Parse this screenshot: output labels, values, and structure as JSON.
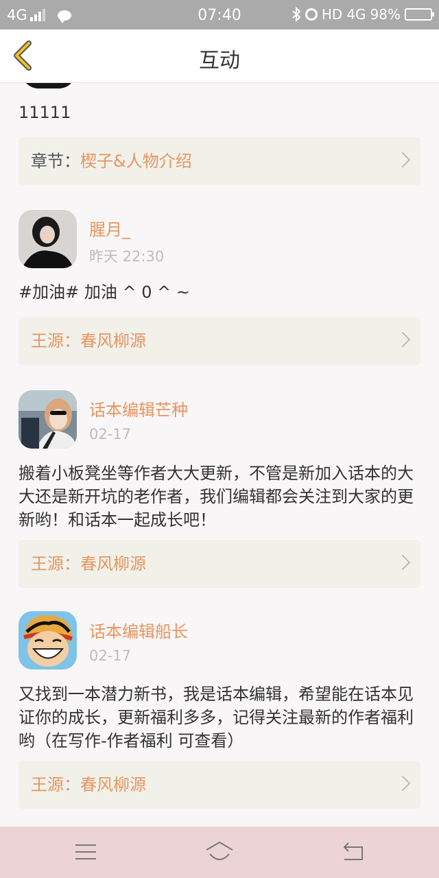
{
  "status_bar": {
    "network": "4G",
    "time": "07:40",
    "hd": "HD",
    "network_right": "4G",
    "battery": "98%",
    "battery_level": 0.98
  },
  "header": {
    "title": "互动"
  },
  "posts": [
    {
      "text": "11111",
      "link_label": "章节：",
      "link_value": "楔子&人物介绍"
    },
    {
      "username": "腥月_",
      "date": "昨天 22:30",
      "text": "#加油# 加油 ^ 0 ^ ~",
      "link_label": "王源：",
      "link_value": "春风柳源"
    },
    {
      "username": "话本编辑芒种",
      "date": "02-17",
      "text": "搬着小板凳坐等作者大大更新，不管是新加入话本的大大还是新开坑的老作者，我们编辑都会关注到大家的更新哟！和话本一起成长吧！",
      "link_label": "王源：",
      "link_value": "春风柳源"
    },
    {
      "username": "话本编辑船长",
      "date": "02-17",
      "text": "又找到一本潜力新书，我是话本编辑，希望能在话本见证你的成长，更新福利多多，记得关注最新的作者福利哟（在写作-作者福利 可查看）",
      "link_label": "王源：",
      "link_value": "春风柳源"
    }
  ]
}
